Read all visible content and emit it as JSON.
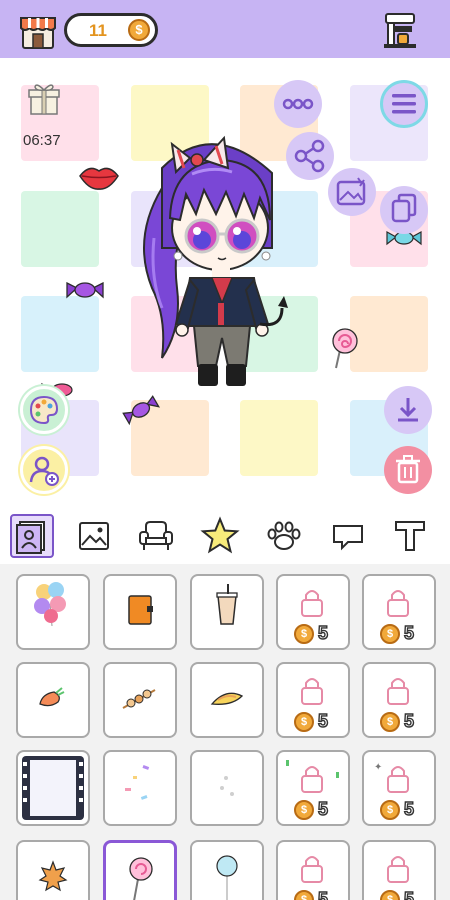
{
  "topbar": {
    "coins": "11",
    "coin_symbol": "$",
    "shop_icon": "shop-icon",
    "machine_icon": "coffee-machine-icon",
    "bg_color": "#c7b4f3"
  },
  "scene": {
    "timer": "06:37",
    "gift_icon": "gift-icon"
  },
  "side_buttons": {
    "more": "more-icon",
    "menu": "menu-icon",
    "share": "share-icon",
    "background": "background-icon",
    "copy": "copy-icon",
    "palette": "palette-icon",
    "add_character": "add-character-icon",
    "download": "download-icon",
    "delete": "trash-icon"
  },
  "categories": [
    {
      "icon": "portrait-icon",
      "active": true
    },
    {
      "icon": "image-icon",
      "active": false
    },
    {
      "icon": "armchair-icon",
      "active": false
    },
    {
      "icon": "star-icon",
      "active": false
    },
    {
      "icon": "paw-icon",
      "active": false
    },
    {
      "icon": "speech-bubble-icon",
      "active": false
    },
    {
      "icon": "text-icon",
      "active": false
    }
  ],
  "items": {
    "price": "5",
    "coin_symbol": "$",
    "rows": [
      [
        "balloons",
        "notebook",
        "bubble-tea",
        "locked",
        "locked"
      ],
      [
        "carrot",
        "skewer",
        "taco",
        "locked",
        "locked"
      ],
      [
        "film-frame",
        "sprinkles",
        "dots",
        "locked",
        "locked"
      ],
      [
        "maple-leaf",
        "lollipop",
        "balloon",
        "locked",
        "locked"
      ]
    ]
  }
}
